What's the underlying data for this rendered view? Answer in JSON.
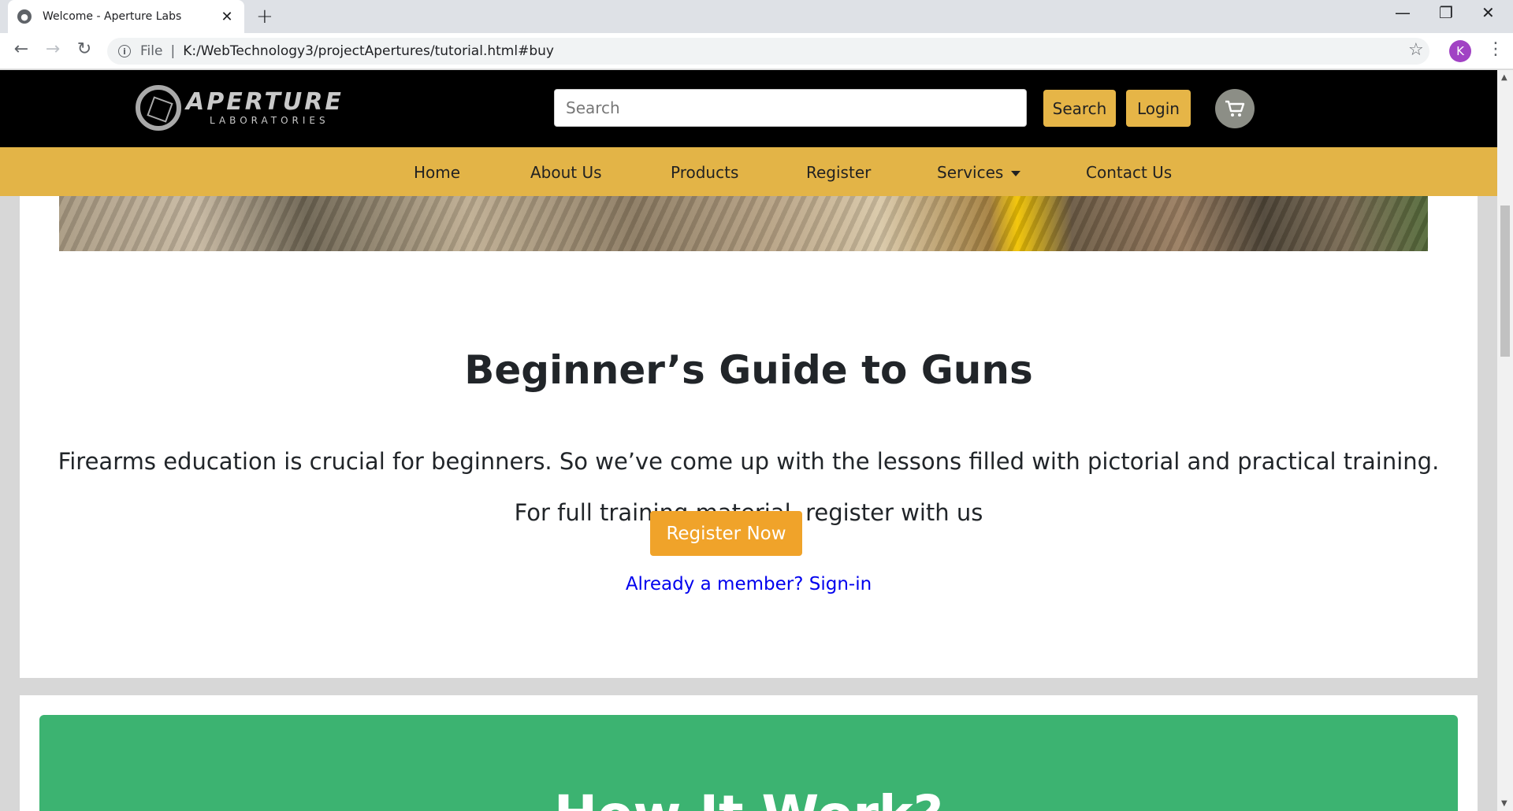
{
  "browser": {
    "tab_title": "Welcome - Aperture Labs",
    "url_scheme": "File",
    "url": "K:/WebTechnology3/projectApertures/tutorial.html#buy",
    "profile_initial": "K"
  },
  "header": {
    "logo_word": "APERTURE",
    "logo_sub": "LABORATORIES",
    "search_placeholder": "Search",
    "search_button": "Search",
    "login_button": "Login"
  },
  "nav": {
    "items": [
      "Home",
      "About Us",
      "Products",
      "Register",
      "Services",
      "Contact Us"
    ]
  },
  "guide": {
    "title": "Beginner’s Guide to Guns",
    "description": "Firearms education is crucial for beginners. So we’ve come up with the lessons filled with pictorial and practical training.",
    "cta_text": "For full training material, register with us",
    "register_button": "Register Now",
    "signin_link": "Already a member? Sign-in"
  },
  "how": {
    "title": "How It Work?"
  },
  "colors": {
    "header_bg": "#000000",
    "nav_bg": "#e3b447",
    "gold_button": "#e6b547",
    "register_button": "#f0a32a",
    "link": "#0000ee",
    "green_section": "#3cb371"
  }
}
